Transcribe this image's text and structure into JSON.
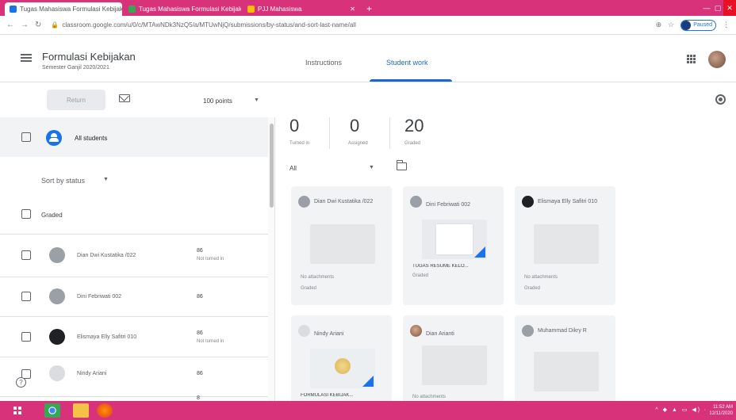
{
  "browser": {
    "tabs": [
      {
        "title": "Tugas Mahasiswa Formulasi Kebijakan",
        "active": true
      },
      {
        "title": "Tugas Mahasiswa Formulasi Kebijakan",
        "active": false
      },
      {
        "title": "PJJ Mahasiswa",
        "active": false
      }
    ],
    "url": "classroom.google.com/u/0/c/MTAwNDk3NzQ5/a/MTUwNjQ/submissions/by-status/and-sort-last-name/all",
    "profile_label": "Paused"
  },
  "header": {
    "course_title": "Formulasi Kebijakan",
    "course_subtitle": "Semester Ganjil 2020/2021",
    "tabs": [
      {
        "label": "Instructions",
        "selected": false
      },
      {
        "label": "Student work",
        "selected": true
      }
    ]
  },
  "toolbar": {
    "return_label": "Return",
    "points_label": "100 points"
  },
  "left": {
    "all_students_label": "All students",
    "sort_label": "Sort by status",
    "section_label": "Graded",
    "students": [
      {
        "name": "Dian Dwi Kustatika /022",
        "grade": "86",
        "status": "Not turned in"
      },
      {
        "name": "Dini Febriwati 002",
        "grade": "86",
        "status": ""
      },
      {
        "name": "Elismaya Elly Safitri 010",
        "grade": "86",
        "status": "Not turned in"
      },
      {
        "name": "Nindy Ariani",
        "grade": "86",
        "status": ""
      },
      {
        "name": "",
        "grade": "8",
        "status": ""
      }
    ],
    "help_symbol": "?"
  },
  "right": {
    "counts": [
      {
        "value": "0",
        "label": "Turned in"
      },
      {
        "value": "0",
        "label": "Assigned"
      },
      {
        "value": "20",
        "label": "Graded"
      }
    ],
    "filter_label": "All",
    "cards": [
      {
        "name": "Dian Dwi Kustatika /022",
        "file": "",
        "note": "No attachments",
        "status": "Graded"
      },
      {
        "name": "Dini Febriwati 002",
        "file": "TUGAS RESUME KELO...",
        "note": "",
        "status": "Graded"
      },
      {
        "name": "Elismaya Elly Safitri 010",
        "file": "",
        "note": "No attachments",
        "status": "Graded"
      },
      {
        "name": "Nindy Ariani",
        "file": "FORMULASI KEBIJAK...",
        "note": "",
        "status": ""
      },
      {
        "name": "Dian Arianti",
        "file": "",
        "note": "No attachments",
        "status": ""
      },
      {
        "name": "Muhammad Dikry R",
        "file": "",
        "note": "",
        "status": ""
      }
    ]
  },
  "taskbar": {
    "tray": "^ ◆ ▲ ▭ ◀) ∙",
    "time": "11:52 AM",
    "date": "12/11/2020"
  }
}
